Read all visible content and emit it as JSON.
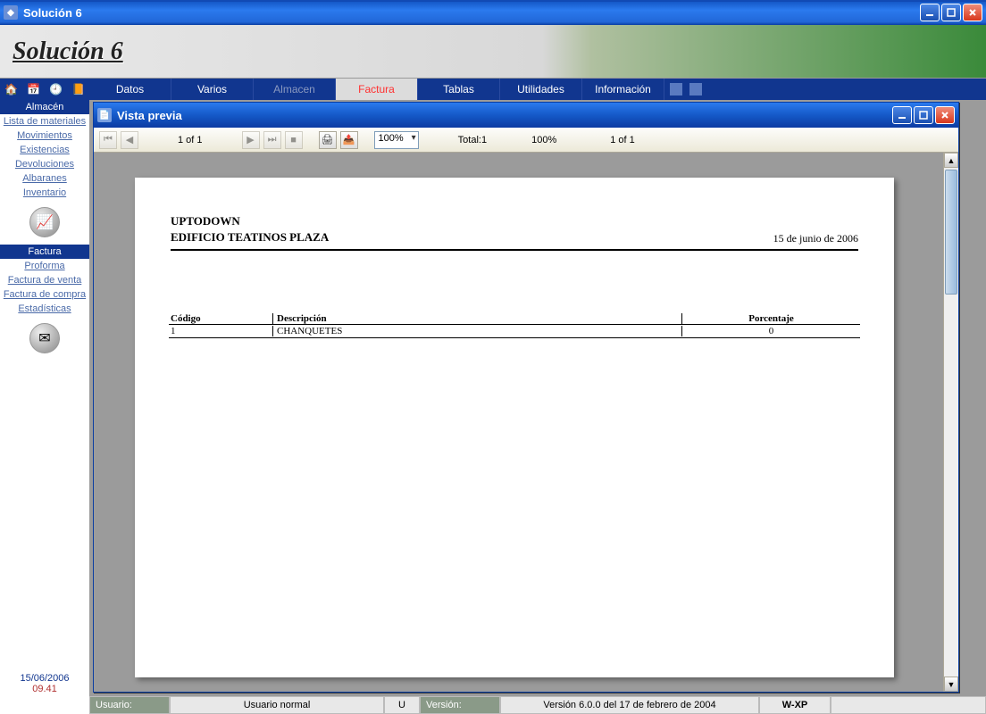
{
  "window": {
    "title": "Solución 6"
  },
  "banner": {
    "title": "Solución 6"
  },
  "nav": {
    "items": [
      {
        "label": "Datos"
      },
      {
        "label": "Varios"
      },
      {
        "label": "Almacen"
      },
      {
        "label": "Factura"
      },
      {
        "label": "Tablas"
      },
      {
        "label": "Utilidades"
      },
      {
        "label": "Información"
      }
    ]
  },
  "sidebar": {
    "section_almacen": "Almacén",
    "almacen_items": [
      "Lista de materiales",
      "Movimientos",
      "Existencias",
      "Devoluciones",
      "Albaranes",
      "Inventario"
    ],
    "section_factura": "Factura",
    "factura_items": [
      "Proforma",
      "Factura de venta",
      "Factura de compra",
      "Estadísticas"
    ],
    "date": "15/06/2006",
    "time": "09.41"
  },
  "preview": {
    "title": "Vista previa",
    "page_counter": "1 of 1",
    "zoom": "100%",
    "total_label": "Total:1",
    "percent": "100%",
    "page_of": "1 of 1"
  },
  "document": {
    "company_line1": "UPTODOWN",
    "company_line2": "EDIFICIO TEATINOS PLAZA",
    "date": "15 de junio de 2006",
    "headers": {
      "codigo": "Código",
      "descripcion": "Descripción",
      "porcentaje": "Porcentaje"
    },
    "rows": [
      {
        "codigo": "1",
        "descripcion": "CHANQUETES",
        "porcentaje": "0"
      }
    ]
  },
  "status": {
    "usuario_label": "Usuario:",
    "usuario_value": "Usuario normal",
    "u": "U",
    "version_label": "Versión:",
    "version_value": "Versión 6.0.0 del 17 de febrero de 2004",
    "os": "W-XP"
  }
}
